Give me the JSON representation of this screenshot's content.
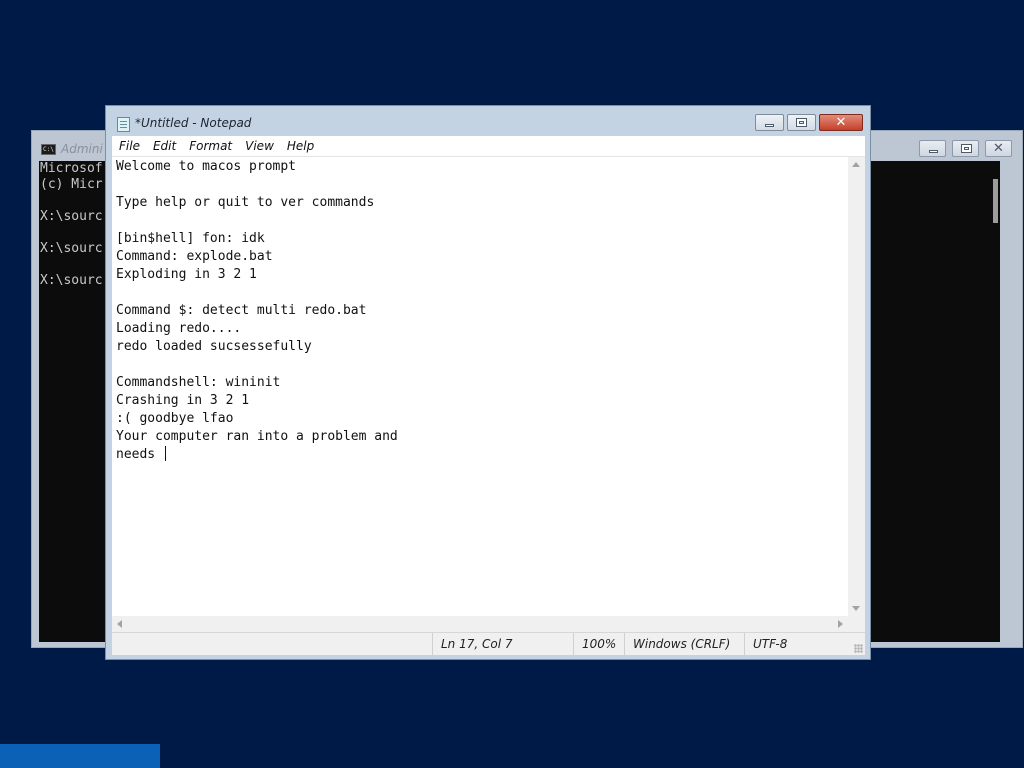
{
  "cmd_window": {
    "icon_text": "C:\\",
    "title": "Admini",
    "lines": [
      "Microsof",
      "(c) Micr",
      "",
      "X:\\sourc",
      "",
      "X:\\sourc",
      "",
      "X:\\sourc"
    ]
  },
  "notepad": {
    "title": "*Untitled - Notepad",
    "menu": [
      "File",
      "Edit",
      "Format",
      "View",
      "Help"
    ],
    "text_lines": [
      "Welcome to macos prompt",
      "",
      "Type help or quit to ver commands",
      "",
      "[bin$hell] fon: idk",
      "Command: explode.bat",
      "Exploding in 3 2 1",
      "",
      "Command $: detect multi redo.bat",
      "Loading redo....",
      "redo loaded sucsessefully",
      "",
      "Commandshell: wininit",
      "Crashing in 3 2 1",
      ":( goodbye lfao",
      "Your computer ran into a problem and",
      "needs "
    ],
    "status": {
      "position": "Ln 17, Col 7",
      "zoom": "100%",
      "line_ending": "Windows (CRLF)",
      "encoding": "UTF-8"
    }
  },
  "colors": {
    "desktop": "#001a47",
    "taskbar_tile": "#0a61b5",
    "close_button": "#c4402a"
  }
}
